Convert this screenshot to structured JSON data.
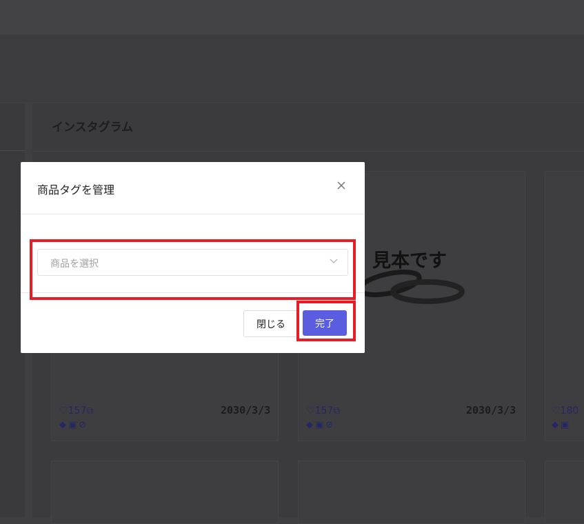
{
  "page": {
    "section_title": "インスタグラム",
    "sample_text": "見本です"
  },
  "posts": [
    {
      "likes": "157",
      "date": "2030/3/3"
    },
    {
      "likes": "157",
      "date": "2030/3/3"
    },
    {
      "likes": "180",
      "date": ""
    }
  ],
  "modal": {
    "title": "商品タグを管理",
    "select_placeholder": "商品を選択",
    "close_label": "閉じる",
    "done_label": "完了"
  },
  "colors": {
    "accent": "#5a5de0",
    "highlight": "#e81c24",
    "overlay": "#3f3e40"
  },
  "icons": [
    "close-icon",
    "chevron-down-icon",
    "heart-icon",
    "external-link-icon",
    "tag-icon",
    "image-icon",
    "ban-icon"
  ]
}
